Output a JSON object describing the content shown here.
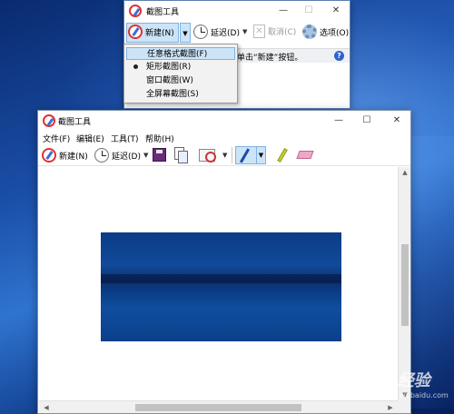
{
  "small_window": {
    "title": "截图工具",
    "controls": {
      "minimize": "—",
      "maximize": "☐",
      "close": "✕"
    },
    "toolbar": {
      "new_label": "新建(N)",
      "delay_label": "延迟(D)",
      "cancel_label": "取消(C)",
      "options_label": "选项(O)"
    },
    "hint": "单击“新建”按钮。",
    "help": "?"
  },
  "new_menu": {
    "items": [
      {
        "label": "任意格式截图(F)",
        "selected": false,
        "hovered": true
      },
      {
        "label": "矩形截图(R)",
        "selected": true,
        "hovered": false
      },
      {
        "label": "窗口截图(W)",
        "selected": false,
        "hovered": false
      },
      {
        "label": "全屏幕截图(S)",
        "selected": false,
        "hovered": false
      }
    ]
  },
  "large_window": {
    "title": "截图工具",
    "controls": {
      "minimize": "—",
      "maximize": "☐",
      "close": "✕"
    },
    "menu": [
      "文件(F)",
      "编辑(E)",
      "工具(T)",
      "帮助(H)"
    ],
    "toolbar": {
      "new_label": "新建(N)",
      "delay_label": "延迟(D)"
    }
  },
  "watermark": {
    "main": "Baidu经验",
    "sub": "jingyan.baidu.com"
  },
  "icons": [
    "snipping-tool-icon",
    "clock-icon",
    "cancel-icon",
    "gear-icon",
    "help-icon",
    "save-icon",
    "copy-icon",
    "send-icon",
    "pen-icon",
    "highlighter-icon",
    "eraser-icon"
  ],
  "colors": {
    "accent_hover": "#cce4f7",
    "accent_border": "#7fb2e0",
    "desktop": "#1a4fa8"
  }
}
